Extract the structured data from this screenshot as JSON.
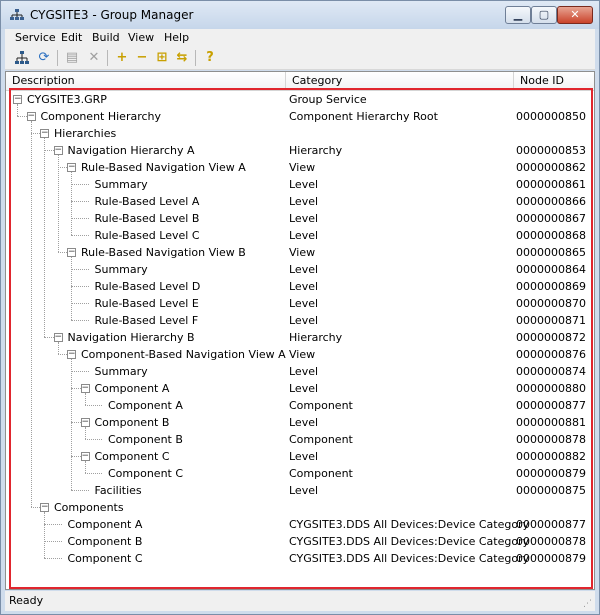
{
  "window": {
    "title": "CYGSITE3 - Group Manager",
    "app_icon": "tree-network-icon",
    "controls": [
      "minimize-icon",
      "maximize-icon",
      "close-icon"
    ]
  },
  "menu": [
    "Service",
    "Edit",
    "Build",
    "View",
    "Help"
  ],
  "toolbar": [
    {
      "icon": "tree-view-icon",
      "enabled": true
    },
    {
      "icon": "refresh-icon",
      "enabled": true
    },
    {
      "icon": "properties-icon",
      "enabled": false
    },
    {
      "icon": "delete-icon",
      "enabled": false
    },
    {
      "icon": "add-icon",
      "enabled": true
    },
    {
      "icon": "remove-icon",
      "enabled": true
    },
    {
      "icon": "add-group-icon",
      "enabled": true
    },
    {
      "icon": "move-icon",
      "enabled": true
    },
    {
      "icon": "help-icon",
      "enabled": true
    }
  ],
  "columns": {
    "description": "Description",
    "category": "Category",
    "node_id": "Node ID"
  },
  "rows": [
    {
      "level": 0,
      "desc": "CYGSITE3.GRP",
      "cat": "Group Service",
      "id": "",
      "expander": "minus"
    },
    {
      "level": 1,
      "desc": "Component Hierarchy",
      "cat": "Component Hierarchy Root",
      "id": "0000000850",
      "expander": "minus"
    },
    {
      "level": 2,
      "desc": "Hierarchies",
      "cat": "",
      "id": "",
      "expander": "minus"
    },
    {
      "level": 3,
      "desc": "Navigation Hierarchy A",
      "cat": "Hierarchy",
      "id": "0000000853",
      "expander": "minus"
    },
    {
      "level": 4,
      "desc": "Rule-Based Navigation View A",
      "cat": "View",
      "id": "0000000862",
      "expander": "minus"
    },
    {
      "level": 5,
      "desc": "Summary",
      "cat": "Level",
      "id": "0000000861",
      "expander": ""
    },
    {
      "level": 5,
      "desc": "Rule-Based Level A",
      "cat": "Level",
      "id": "0000000866",
      "expander": ""
    },
    {
      "level": 5,
      "desc": "Rule-Based Level B",
      "cat": "Level",
      "id": "0000000867",
      "expander": ""
    },
    {
      "level": 5,
      "desc": "Rule-Based Level C",
      "cat": "Level",
      "id": "0000000868",
      "expander": ""
    },
    {
      "level": 4,
      "desc": "Rule-Based Navigation View B",
      "cat": "View",
      "id": "0000000865",
      "expander": "minus"
    },
    {
      "level": 5,
      "desc": "Summary",
      "cat": "Level",
      "id": "0000000864",
      "expander": ""
    },
    {
      "level": 5,
      "desc": "Rule-Based Level D",
      "cat": "Level",
      "id": "0000000869",
      "expander": ""
    },
    {
      "level": 5,
      "desc": "Rule-Based Level E",
      "cat": "Level",
      "id": "0000000870",
      "expander": ""
    },
    {
      "level": 5,
      "desc": "Rule-Based Level F",
      "cat": "Level",
      "id": "0000000871",
      "expander": ""
    },
    {
      "level": 3,
      "desc": "Navigation Hierarchy B",
      "cat": "Hierarchy",
      "id": "0000000872",
      "expander": "minus"
    },
    {
      "level": 4,
      "desc": "Component-Based Navigation View A",
      "cat": "View",
      "id": "0000000876",
      "expander": "minus"
    },
    {
      "level": 5,
      "desc": "Summary",
      "cat": "Level",
      "id": "0000000874",
      "expander": ""
    },
    {
      "level": 5,
      "desc": "Component A",
      "cat": "Level",
      "id": "0000000880",
      "expander": "minus"
    },
    {
      "level": 6,
      "desc": "Component A",
      "cat": "Component",
      "id": "0000000877",
      "expander": ""
    },
    {
      "level": 5,
      "desc": "Component B",
      "cat": "Level",
      "id": "0000000881",
      "expander": "minus"
    },
    {
      "level": 6,
      "desc": "Component B",
      "cat": "Component",
      "id": "0000000878",
      "expander": ""
    },
    {
      "level": 5,
      "desc": "Component C",
      "cat": "Level",
      "id": "0000000882",
      "expander": "minus"
    },
    {
      "level": 6,
      "desc": "Component C",
      "cat": "Component",
      "id": "0000000879",
      "expander": ""
    },
    {
      "level": 5,
      "desc": "Facilities",
      "cat": "Level",
      "id": "0000000875",
      "expander": ""
    },
    {
      "level": 2,
      "desc": "Components",
      "cat": "",
      "id": "",
      "expander": "minus"
    },
    {
      "level": 3,
      "desc": "Component A",
      "cat": "CYGSITE3.DDS All Devices:Device Category",
      "id": "0000000877",
      "expander": ""
    },
    {
      "level": 3,
      "desc": "Component B",
      "cat": "CYGSITE3.DDS All Devices:Device Category",
      "id": "0000000878",
      "expander": ""
    },
    {
      "level": 3,
      "desc": "Component C",
      "cat": "CYGSITE3.DDS All Devices:Device Category",
      "id": "0000000879",
      "expander": ""
    }
  ],
  "status": {
    "text": "Ready"
  },
  "highlight_color": "#e0262e"
}
